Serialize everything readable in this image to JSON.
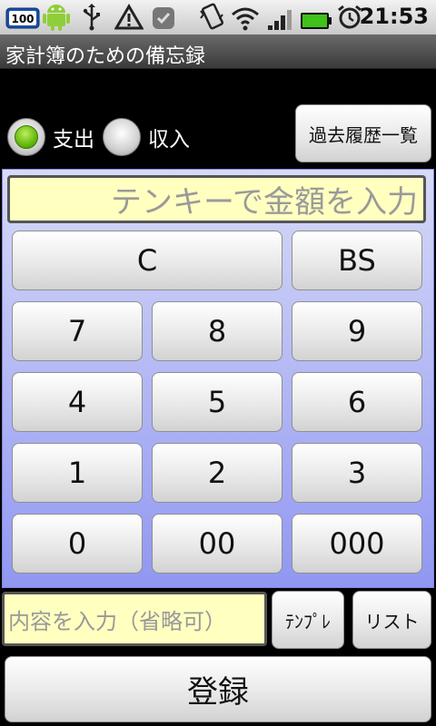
{
  "status_bar": {
    "battery_badge": "100",
    "time": "21:53",
    "icons": [
      "battery-percent-icon",
      "android-icon",
      "usb-icon",
      "warning-icon",
      "shield-icon",
      "vibrate-icon",
      "wifi-icon",
      "signal-icon",
      "battery-icon",
      "alarm-icon"
    ]
  },
  "app": {
    "title": "家計簿のための備忘録"
  },
  "type_selector": {
    "selected": "expense",
    "expense_label": "支出",
    "income_label": "収入"
  },
  "history_button": {
    "label": "過去履歴一覧"
  },
  "amount_input": {
    "placeholder": "テンキーで金額を入力"
  },
  "keypad": {
    "clear": "C",
    "backspace": "BS",
    "keys": [
      "7",
      "8",
      "9",
      "4",
      "5",
      "6",
      "1",
      "2",
      "3",
      "0",
      "00",
      "000"
    ]
  },
  "memo_input": {
    "placeholder": "内容を入力（省略可）"
  },
  "template_button": {
    "label": "ﾃﾝﾌﾟﾚ"
  },
  "list_button": {
    "label": "リスト"
  },
  "register_button": {
    "label": "登録"
  },
  "colors": {
    "panel_top": "#d7daf7",
    "panel_bottom": "#9097f2",
    "input_bg": "#ffffc0",
    "radio_selected": "#5fb30a"
  }
}
